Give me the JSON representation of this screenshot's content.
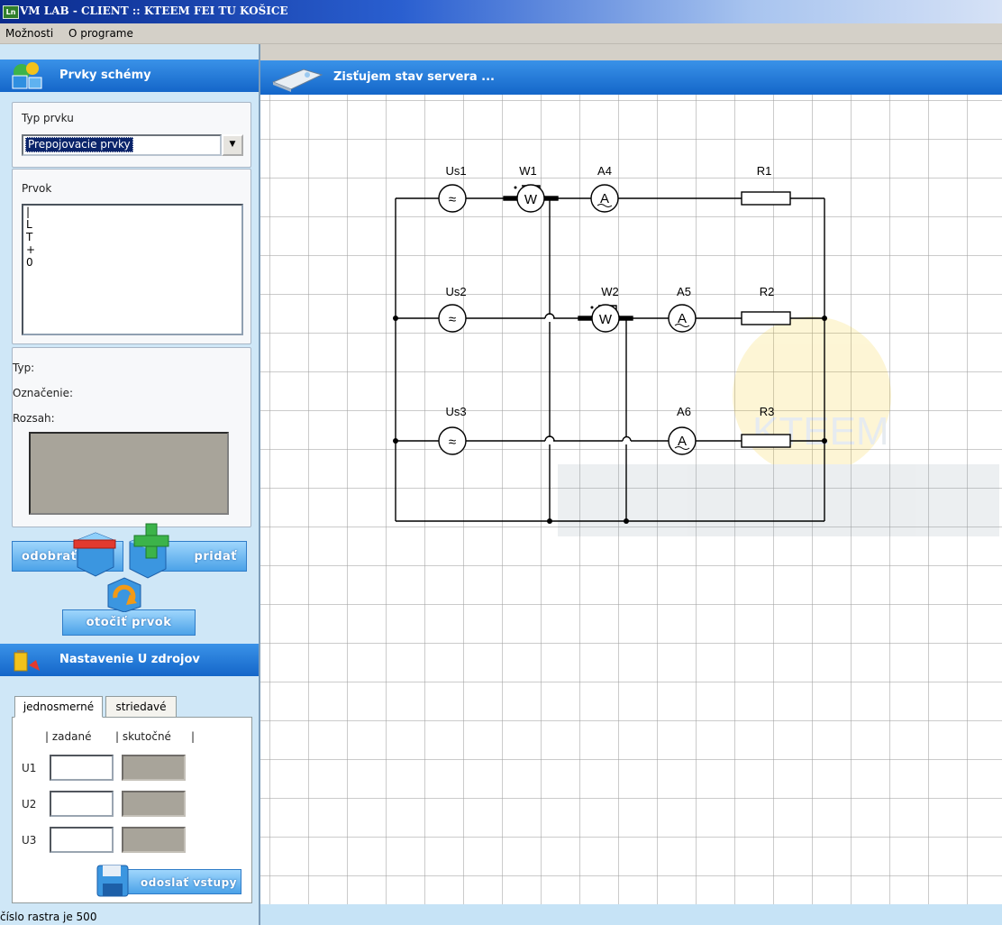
{
  "window": {
    "title": "VM LAB - CLIENT :: KTEEM FEI TU KOŠICE",
    "icon_text": "Ln"
  },
  "menu": {
    "items": [
      "Možnosti",
      "O programe"
    ]
  },
  "elements_panel": {
    "header": "Prvky schémy",
    "type_label": "Typ prvku",
    "type_value": "Prepojovacie prvky",
    "element_label": "Prvok",
    "elements": [
      "|",
      "L",
      "T",
      "+",
      "0"
    ],
    "info": {
      "type_label": "Typ:",
      "marking_label": "Označenie:",
      "range_label": "Rozsah:"
    }
  },
  "actions": {
    "remove": "odobrať",
    "add": "pridať",
    "rotate": "otočiť prvok"
  },
  "sources_panel": {
    "header": "Nastavenie U zdrojov",
    "tabs": [
      "jednosmerné",
      "striedavé"
    ],
    "active_tab": 0,
    "col_set": "| zadané",
    "col_actual": "| skutočné",
    "col_end": "|",
    "rows": [
      "U1",
      "U2",
      "U3"
    ],
    "send_button": "odoslať vstupy"
  },
  "status": {
    "text": "číslo rastra je 500"
  },
  "canvas": {
    "header": "Zisťujem stav servera ...",
    "labels": {
      "us1": "Us1",
      "us2": "Us2",
      "us3": "Us3",
      "w1": "W1",
      "w2": "W2",
      "a4": "A4",
      "a5": "A5",
      "a6": "A6",
      "r1": "R1",
      "r2": "R2",
      "r3": "R3"
    },
    "symbols": {
      "source": "≈",
      "ammeter": "A",
      "wattmeter": "W"
    },
    "watermark": "KTEEM"
  },
  "colors": {
    "header_blue": "#1466c9",
    "panel_bg": "#cfe7f7",
    "selection": "#0a246a"
  }
}
